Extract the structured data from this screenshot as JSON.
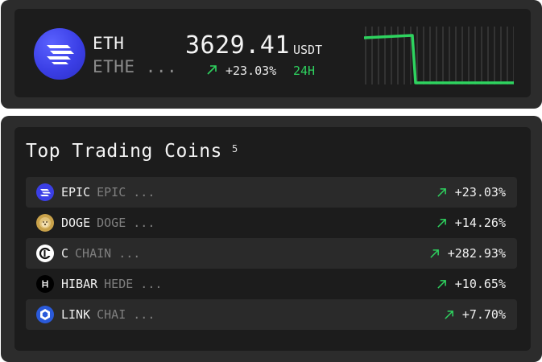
{
  "featured": {
    "symbol": "ETH",
    "name": "ETHE ...",
    "price": "3629.41",
    "unit": "USDT",
    "change": "+23.03%",
    "period": "24H",
    "icon": "epic-stack-icon",
    "accent_color": "#2ed35f",
    "logo_color": "#3b3fe6"
  },
  "list": {
    "title": "Top Trading Coins",
    "count": "5",
    "coins": [
      {
        "symbol": "EPIC",
        "name": "EPIC ...",
        "change": "+23.03%",
        "icon": "epic-icon",
        "color": "#3b3fe6"
      },
      {
        "symbol": "DOGE",
        "name": "DOGE ...",
        "change": "+14.26%",
        "icon": "doge-icon",
        "color": "#c9a24a"
      },
      {
        "symbol": "C",
        "name": "CHAIN ...",
        "change": "+282.93%",
        "icon": "chain-icon",
        "color": "#ffffff"
      },
      {
        "symbol": "HIBAR",
        "name": "HEDE ...",
        "change": "+10.65%",
        "icon": "hedera-icon",
        "color": "#000000"
      },
      {
        "symbol": "LINK",
        "name": "CHAI ...",
        "change": "+7.70%",
        "icon": "chainlink-icon",
        "color": "#2a5ada"
      }
    ]
  }
}
